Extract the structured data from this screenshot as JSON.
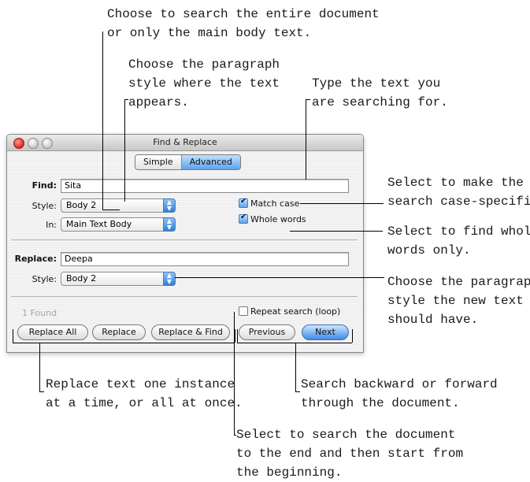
{
  "callouts": {
    "search_scope": "Choose to search the entire document\nor only the main body text.",
    "para_style_find": "Choose the paragraph\nstyle where the text\nappears.",
    "type_text": "Type the text you\nare searching for.",
    "match_case": "Select to make the\nsearch case-specific.",
    "whole_words": "Select to find whole\nwords only.",
    "para_style_new": "Choose the paragraph\nstyle the new text\nshould have.",
    "replace": "Replace text one instance\nat a time, or all at once.",
    "direction": "Search backward or forward\nthrough the document.",
    "loop": "Select to search the document\nto the end and then start from\nthe beginning."
  },
  "window": {
    "title": "Find & Replace",
    "tabs": [
      "Simple",
      "Advanced"
    ],
    "find": {
      "label": "Find:",
      "value": "Sita",
      "style_label": "Style:",
      "style_value": "Body 2",
      "in_label": "In:",
      "in_value": "Main Text Body",
      "match_case": "Match case",
      "whole_words": "Whole words"
    },
    "replace": {
      "label": "Replace:",
      "value": "Deepa",
      "style_label": "Style:",
      "style_value": "Body 2"
    },
    "status": "1 Found",
    "repeat_loop": "Repeat search (loop)",
    "buttons": {
      "replace_all": "Replace All",
      "replace": "Replace",
      "replace_find": "Replace & Find",
      "previous": "Previous",
      "next": "Next"
    }
  },
  "colors": {
    "accent": "#5ea3ec",
    "close_button": "#d9261c"
  }
}
